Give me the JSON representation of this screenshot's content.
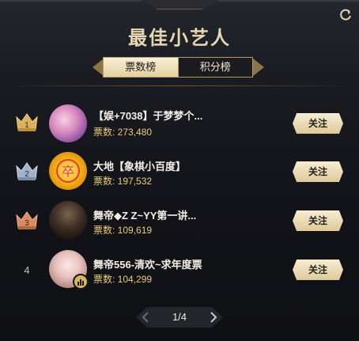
{
  "header": {
    "title": "最佳小艺人",
    "refresh_icon": "refresh-icon"
  },
  "tabs": [
    {
      "label": "票数榜",
      "active": true
    },
    {
      "label": "积分榜",
      "active": false
    }
  ],
  "list": [
    {
      "rank": "1",
      "rank_icon": "crown-gold-icon",
      "name": "【娱+7038】于梦梦个...",
      "votes": "票数: 273,480",
      "follow": "关注"
    },
    {
      "rank": "2",
      "rank_icon": "crown-silver-icon",
      "name": "大地【象棋小百度】",
      "votes": "票数: 197,532",
      "follow": "关注"
    },
    {
      "rank": "3",
      "rank_icon": "crown-bronze-icon",
      "name": "舞帝◆Z Z~YY第一讲...",
      "votes": "票数: 109,619",
      "follow": "关注"
    },
    {
      "rank": "4",
      "rank_icon": "",
      "name": "舞帝556-清欢~求年度票",
      "votes": "票数: 104,299",
      "follow": "关注",
      "live_badge": "live-badge-icon"
    }
  ],
  "pagination": {
    "text": "1/4",
    "prev_icon": "chevron-left-icon",
    "next_icon": "chevron-right-icon"
  },
  "colors": {
    "accent_gold": "#e9cc7b",
    "tab_active_bg": "#e3cf9f",
    "background": "#15171d"
  }
}
